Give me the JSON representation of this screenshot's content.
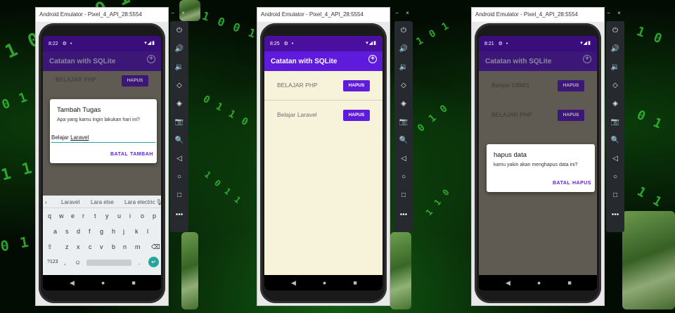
{
  "window_title": "Android Emulator - Pixel_4_API_28:5554",
  "window_controls": "− ×",
  "app_title": "Catatan with SQLite",
  "add_icon_glyph": "+",
  "status_icons": "▾◢▮",
  "status_gear": "⚙",
  "status_dot": "•",
  "nav": "◀●■",
  "hapus_label": "HAPUS",
  "emulator_toolbar_icons": [
    "power-icon",
    "volume-up-icon",
    "volume-down-icon",
    "rotate-left-icon",
    "rotate-right-icon",
    "camera-icon",
    "zoom-icon",
    "back-icon",
    "home-icon",
    "overview-icon",
    "more-icon"
  ],
  "emulator_toolbar_glyphs": [
    "⏻",
    "🔊",
    "🔉",
    "◇",
    "◈",
    "📷",
    "🔍",
    "◁",
    "○",
    "□",
    "•••"
  ],
  "screens": [
    {
      "time": "8:22",
      "items": [
        {
          "title": "BELAJAR PHP"
        }
      ],
      "dialog": {
        "title": "Tambah Tugas",
        "message": "Apa yang kamu ingin lakukan hari ini?",
        "input_prefix": "Belajar ",
        "input_underlined": "Laravel",
        "cancel": "BATAL",
        "confirm": "TAMBAH"
      },
      "keyboard": {
        "suggestions": [
          "Laravel",
          "Lara else",
          "Lara electric"
        ],
        "row1": [
          "q",
          "w",
          "e",
          "r",
          "t",
          "y",
          "u",
          "i",
          "o",
          "p"
        ],
        "row2": [
          "a",
          "s",
          "d",
          "f",
          "g",
          "h",
          "j",
          "k",
          "l"
        ],
        "row3": [
          "z",
          "x",
          "c",
          "v",
          "b",
          "n",
          "m"
        ],
        "symbols_key": "?123",
        "comma_key": ",",
        "period_key": "."
      }
    },
    {
      "time": "8:25",
      "items": [
        {
          "title": "BELAJAR PHP"
        },
        {
          "title": "Belajar Laravel"
        }
      ]
    },
    {
      "time": "8:21",
      "items": [
        {
          "title": "Belajar DBMS"
        },
        {
          "title": "BELAJAR PHP"
        }
      ],
      "dialog": {
        "title": "hapus data",
        "message": "kamu yakin akan menghapus data ini?",
        "cancel": "BATAL",
        "confirm": "HAPUS"
      }
    }
  ]
}
